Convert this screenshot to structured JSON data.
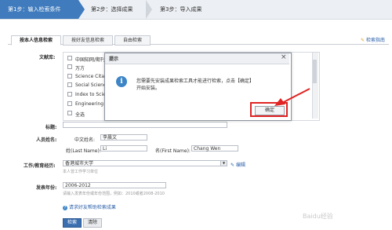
{
  "steps": [
    {
      "label": "第1步：输入检索条件"
    },
    {
      "label": "第2步：选择成果"
    },
    {
      "label": "第3步：导入成果"
    }
  ],
  "tabs": [
    {
      "label": "按本人信息检索"
    },
    {
      "label": "按好友信息检索"
    },
    {
      "label": "自由检索"
    }
  ],
  "help_link": "检索指南",
  "form": {
    "source_label": "文献库:",
    "sources": [
      "中国知网/期刊",
      "万方",
      "Science Citati",
      "Social Science",
      "Index to Scie",
      "Engineering V",
      "全选"
    ],
    "title_label": "标题:",
    "person_label": "人员姓名:",
    "cn_name_label": "中文姓名:",
    "cn_name_value": "李晨文",
    "last_name_label": "姓(Last Name):",
    "last_name_value": "Li",
    "first_name_label": "名(First Name):",
    "first_name_value": "Chang Wen",
    "org_label": "工作/教育经历:",
    "org_value": "香港城市大学",
    "org_edit": "编辑",
    "org_hint": "本人曾工作学习单位",
    "year_label": "发表年份:",
    "year_value": "2006-2012",
    "year_hint": "请输入发表年份或年份范围，例如：2010或者2008-2010",
    "friend_link": "请求好友帮助检索成果",
    "search_button": "检索",
    "clear_button": "清除"
  },
  "dialog": {
    "title": "提示",
    "close": "×",
    "message_line1": "您需要先安装成果检索工具才能进行检索，点击【确定】",
    "message_line2": "开始安装。",
    "icon": "i",
    "ok_button": "确定"
  },
  "watermark": "Baidu经验",
  "colors": {
    "accent": "#3f7bbd",
    "highlight": "#e02424"
  }
}
